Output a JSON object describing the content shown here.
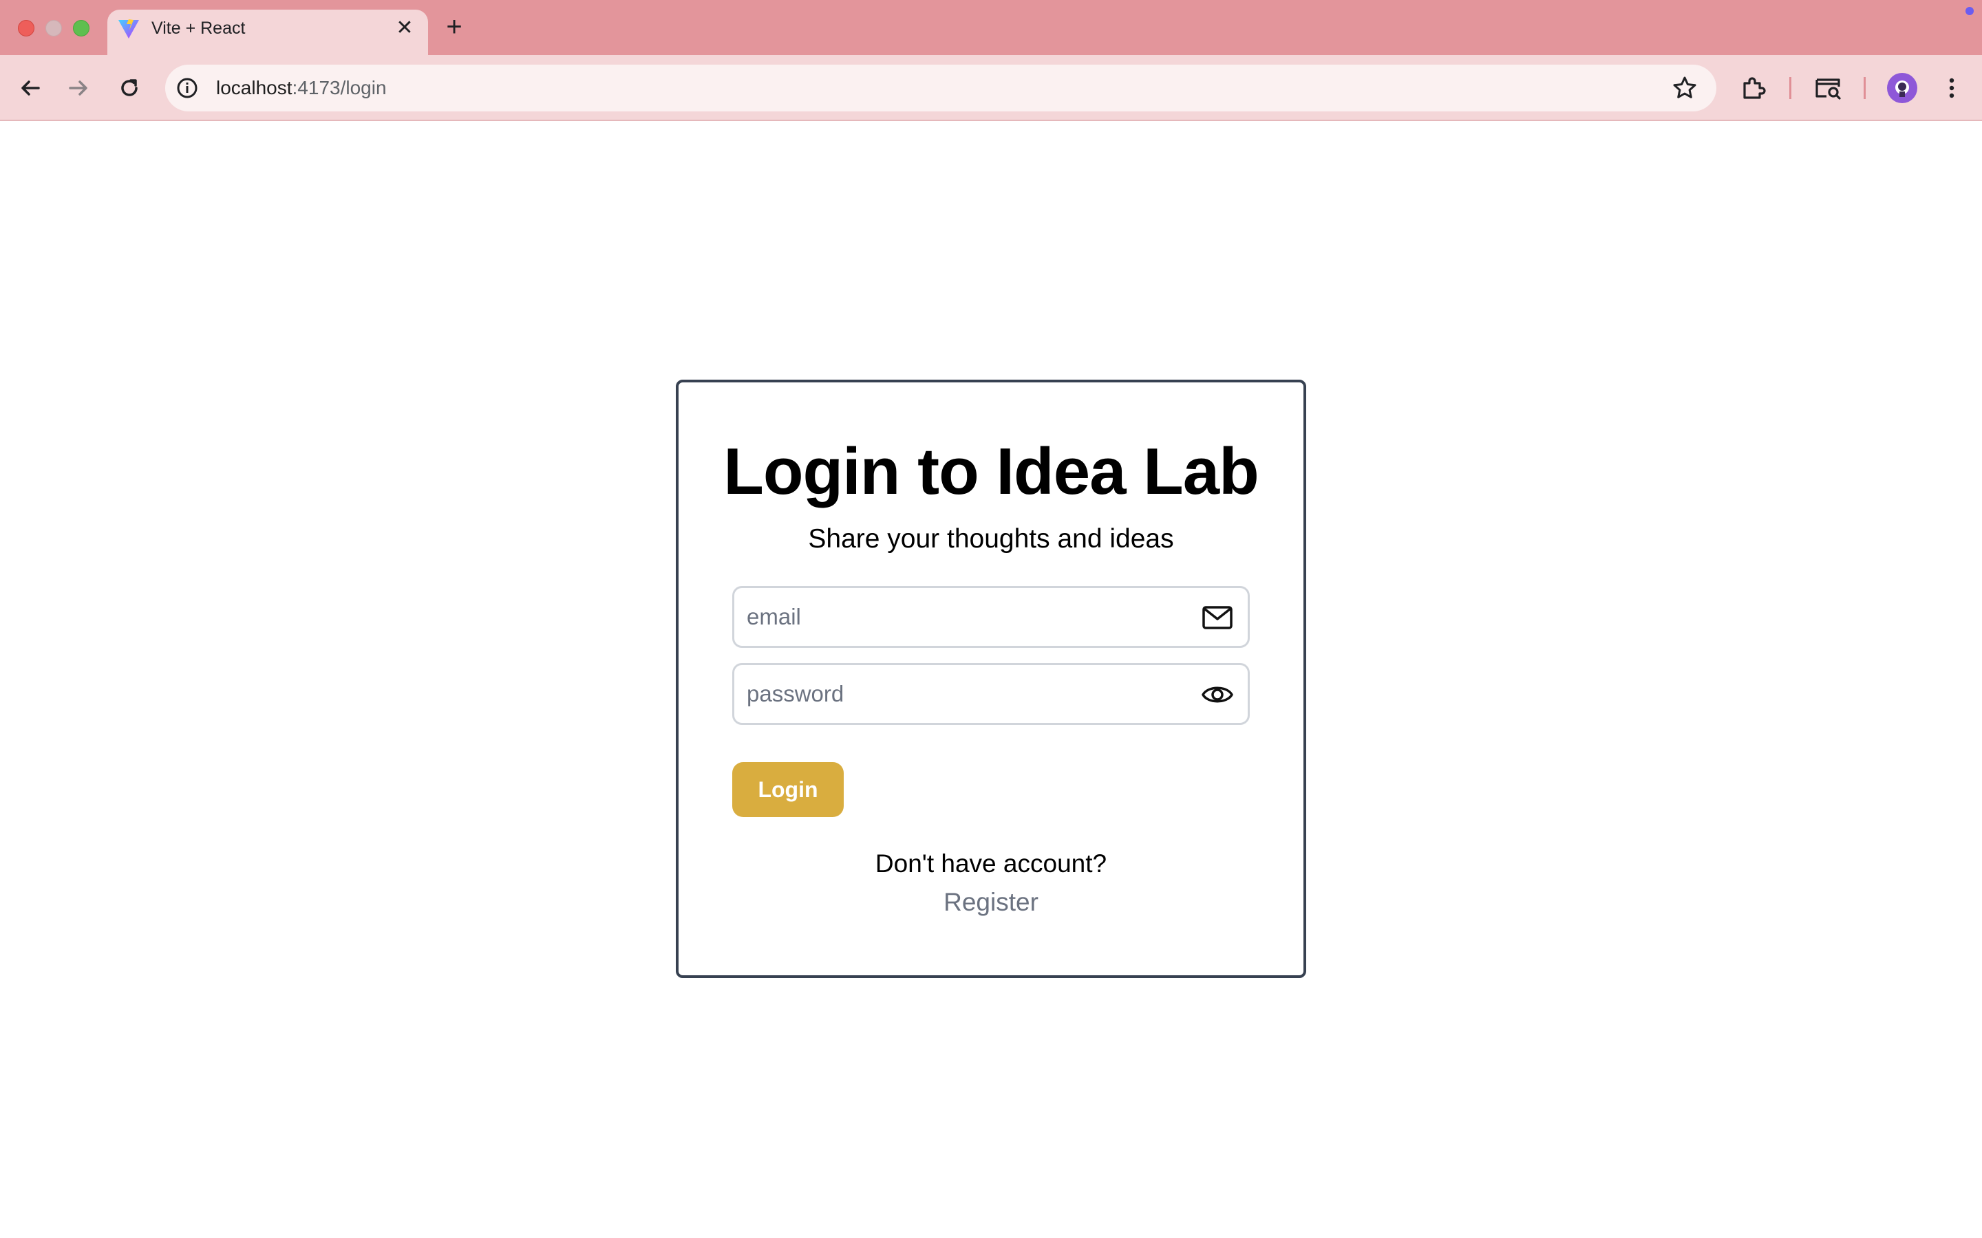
{
  "browser": {
    "tab_title": "Vite + React",
    "tab_close_glyph": "✕",
    "new_tab_glyph": "+",
    "url_host": "localhost",
    "url_rest": ":4173/login",
    "icons": [
      "vite-logo-icon",
      "back-icon",
      "forward-icon",
      "reload-icon",
      "site-info-icon",
      "bookmark-star-icon",
      "extensions-icon",
      "tab-search-icon",
      "profile-avatar",
      "more-menu-icon"
    ]
  },
  "login": {
    "title": "Login to Idea Lab",
    "subtitle": "Share your thoughts and ideas",
    "email_placeholder": "email",
    "email_value": "",
    "password_placeholder": "password",
    "password_value": "",
    "email_icon": "mail-icon",
    "password_icon": "eye-icon",
    "button_label": "Login",
    "no_account_text": "Don't have account?",
    "register_label": "Register"
  },
  "colors": {
    "tabstrip": "#e3959b",
    "toolbar": "#f4d6d8",
    "card_border": "#374151",
    "login_button": "#d9ad3f",
    "register_link": "#6b7280"
  }
}
